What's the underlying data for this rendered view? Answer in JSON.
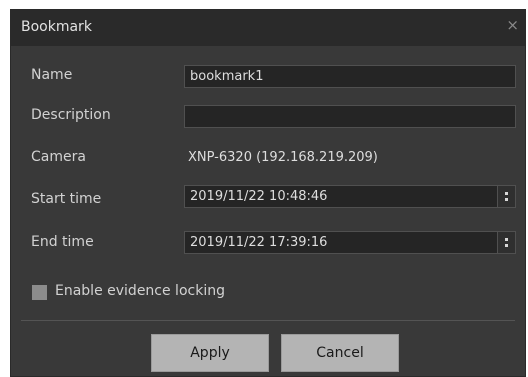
{
  "dialog": {
    "title": "Bookmark",
    "close_symbol": "×"
  },
  "form": {
    "name_label": "Name",
    "name_value": "bookmark1",
    "description_label": "Description",
    "description_value": "",
    "camera_label": "Camera",
    "camera_value": "XNP-6320  (192.168.219.209)",
    "start_time_label": "Start time",
    "start_time_value": "2019/11/22  10:48:46",
    "end_time_label": "End time",
    "end_time_value": "2019/11/22  17:39:16",
    "evidence_lock_label": "Enable evidence locking",
    "evidence_lock_checked": false
  },
  "buttons": {
    "apply": "Apply",
    "cancel": "Cancel"
  },
  "colors": {
    "dialog_background": "#393939",
    "titlebar_background": "#2a2a2a",
    "button_background": "#b4b4b4"
  }
}
